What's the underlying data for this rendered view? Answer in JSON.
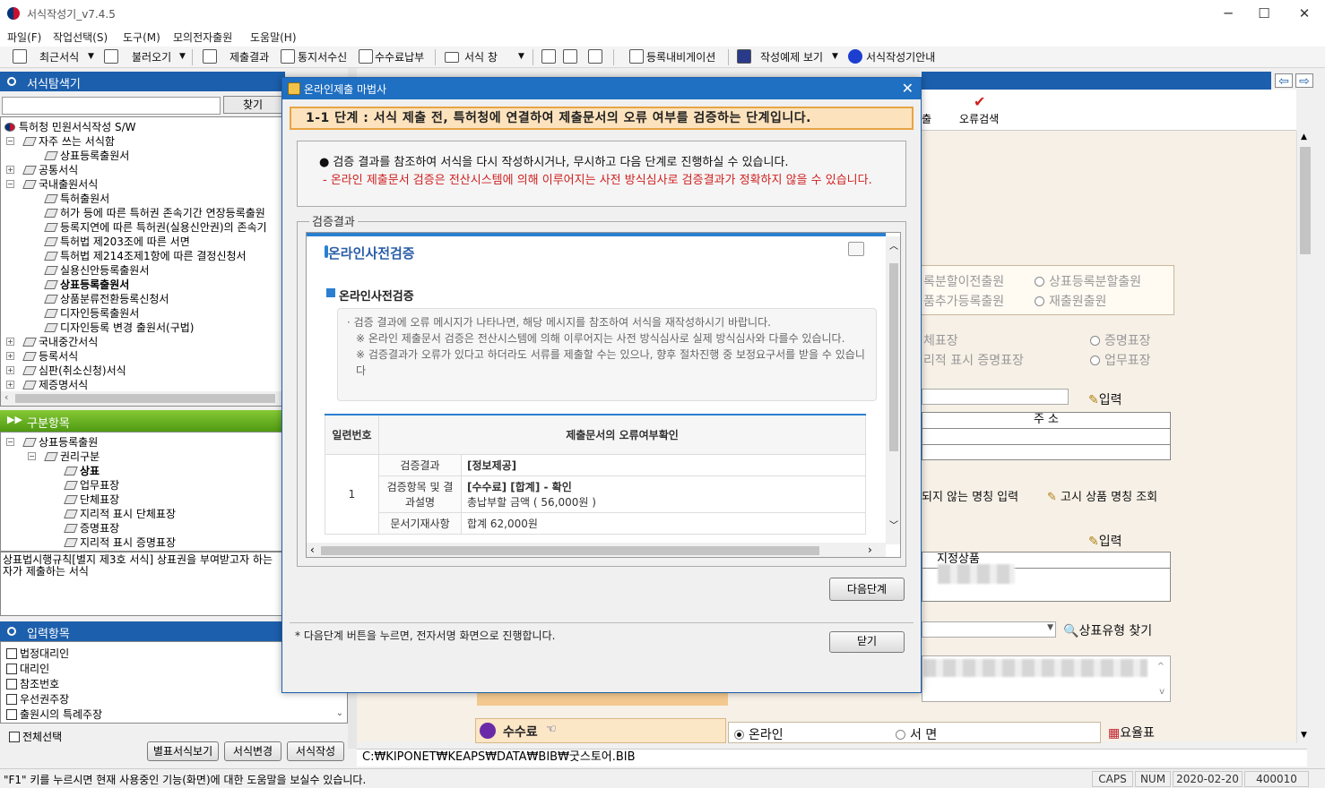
{
  "window": {
    "title": "서식작성기_v7.4.5",
    "minimize": "─",
    "maximize": "☐",
    "close": "✕"
  },
  "menu": [
    "파일(F)",
    "작업선택(S)",
    "도구(M)",
    "모의전자출원",
    "도움말(H)"
  ],
  "toolbar": {
    "recent": "최근서식",
    "open": "불러오기",
    "submit_result": "제출결과",
    "notice_receive": "통지서수신",
    "fee_pay": "수수료납부",
    "form_window": "서식 창",
    "reg_navigation": "등록내비게이션",
    "example_view": "작성예제 보기",
    "guide": "서식작성기안내"
  },
  "form_explorer": {
    "title": "서식탐색기",
    "find_button": "찾기",
    "search_value": "",
    "tree": [
      "특허청 민원서식작성 S/W",
      "자주 쓰는 서식함",
      "상표등록출원서",
      "공통서식",
      "국내출원서식",
      "특허출원서",
      "허가 등에 따른 특허권 존속기간 연장등록출원",
      "등록지연에 따른 특허권(실용신안권)의 존속기",
      "특허법 제203조에 따른 서면",
      "특허법 제214조제1항에 따른 결정신청서",
      "실용신안등록출원서",
      "상표등록출원서",
      "상품분류전환등록신청서",
      "디자인등록출원서",
      "디자인등록 변경 출원서(구법)",
      "국내중간서식",
      "등록서식",
      "심판(취소신청)서식",
      "제증명서식"
    ]
  },
  "classification": {
    "title": "구분항목",
    "tree": [
      "상표등록출원",
      "권리구분",
      "상표",
      "업무표장",
      "단체표장",
      "지리적 표시 단체표장",
      "증명표장",
      "지리적 표시 증명표장"
    ],
    "description": "상표법시행규칙[별지 제3호 서식] 상표권을 부여받고자 하는 자가 제출하는 서식"
  },
  "input_items": {
    "title": "입력항목",
    "items": [
      "법정대리인",
      "대리인",
      "참조번호",
      "우선권주장",
      "출원시의 특례주장"
    ],
    "select_all": "전체선택",
    "btn_separate": "별표서식보기",
    "btn_change": "서식변경",
    "btn_write": "서식작성"
  },
  "editor": {
    "error_check": "오류검색",
    "submit_partial": "출",
    "opt1": "록분할이전출원",
    "opt2": "상표등록분할출원",
    "opt3": "품추가등록출원",
    "opt4": "재출원출원",
    "opt5": "체표장",
    "opt6": "증명표장",
    "opt7": "리적 표시 증명표장",
    "opt8": "업무표장",
    "input_label": "입력",
    "address_header": "주 소",
    "not_listed": "되지 않는 명칭 입력",
    "notice_search": "고시 상품 명칭 조회",
    "designated_goods": "지정상품",
    "trademark_type_search": "상표유형 찾기",
    "fee_label": "수수료",
    "fee_online": "온라인",
    "fee_paper": "서 면",
    "fee_table": "요율표",
    "path": "C:₩KIPONET₩KEAPS₩DATA₩BIB₩굿스토어.BIB"
  },
  "modal": {
    "title": "온라인제출 마법사",
    "step_banner": "1-1 단계 : 서식 제출 전, 특허청에 연결하여 제출문서의 오류 여부를 검증하는 단계입니다.",
    "info_line": "검증 결과를 참조하여 서식을 다시 작성하시거나, 무시하고 다음 단계로 진행하실 수 있습니다.",
    "warning_line": "- 온라인 제출문서 검증은 전산시스템에 의해 이루어지는 사전 방식심사로 검증결과가 정확하지 않을 수 있습니다.",
    "group_label": "검증결과",
    "web_title": "온라인사전검증",
    "web_sub": "온라인사전검증",
    "notice_1": "· 검증 결과에 오류 메시지가 나타나면, 해당 메시지를 참조하여 서식을 재작성하시기 바랍니다.",
    "notice_2": "※ 온라인 제출문서 검증은 전산시스템에 의해 이루어지는 사전 방식심사로 실제 방식심사와 다를수 있습니다.",
    "notice_3": "※ 검증결과가 오류가 있다고 하더라도 서류를 제출할 수는 있으나, 향후 절차진행 중 보정요구서를 받을 수 있습니다",
    "table": {
      "col_no": "일련번호",
      "col_check": "제출문서의 오류여부확인",
      "row_no": "1",
      "rows": [
        {
          "label": "검증결과",
          "value": "[정보제공]"
        },
        {
          "label": "검증항목 및 결과설명",
          "value": "[수수료] [합계] - 확인",
          "value2": "총납부할 금액 ( 56,000원 )"
        },
        {
          "label": "문서기재사항",
          "value": "합계 62,000원"
        }
      ]
    },
    "next_button": "다음단계",
    "footnote": "* 다음단계 버튼을 누르면, 전자서명 화면으로 진행합니다.",
    "close_button": "닫기"
  },
  "statusbar": {
    "help_text": "\"F1\" 키를 누르시면 현재 사용중인 기능(화면)에 대한 도움말을 보실수 있습니다.",
    "caps": "CAPS",
    "num": "NUM",
    "date": "2020-02-20",
    "code": "400010"
  },
  "colors": {
    "accent_blue": "#1c5fad",
    "banner_orange": "#e8a444",
    "warning_red": "#d02020",
    "green_header": "#6db424"
  }
}
